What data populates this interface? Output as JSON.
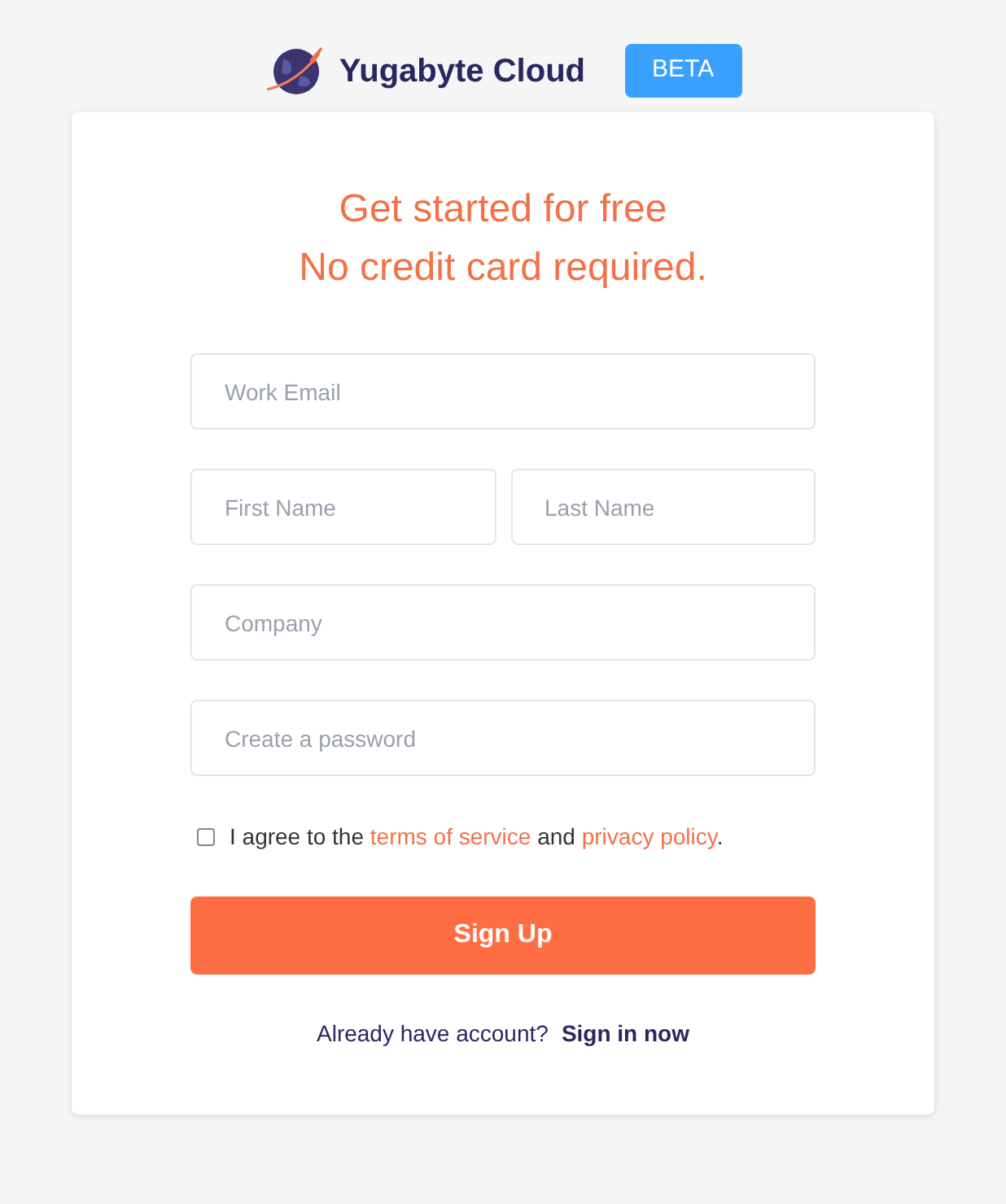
{
  "brand": {
    "name": "Yugabyte Cloud",
    "badge": "BETA"
  },
  "form": {
    "title_lines": [
      "Get started for free",
      "No credit card required."
    ],
    "fields": [
      {
        "kind": "full",
        "placeholder": "Work Email"
      },
      {
        "kind": "half",
        "placeholder": "First Name"
      },
      {
        "kind": "half",
        "placeholder": "Last Name"
      },
      {
        "kind": "full",
        "placeholder": "Company"
      },
      {
        "kind": "full",
        "placeholder": "Create a password"
      }
    ],
    "agreement": {
      "checked": false,
      "parts": [
        {
          "kind": "text",
          "text": "I agree to the "
        },
        {
          "kind": "link",
          "text": "terms of service"
        },
        {
          "kind": "text",
          "text": " and "
        },
        {
          "kind": "link",
          "text": "privacy policy"
        },
        {
          "kind": "text",
          "text": "."
        }
      ]
    },
    "submit": "Sign Up",
    "footer": {
      "text": "Already have account?",
      "link": "Sign in now"
    }
  }
}
